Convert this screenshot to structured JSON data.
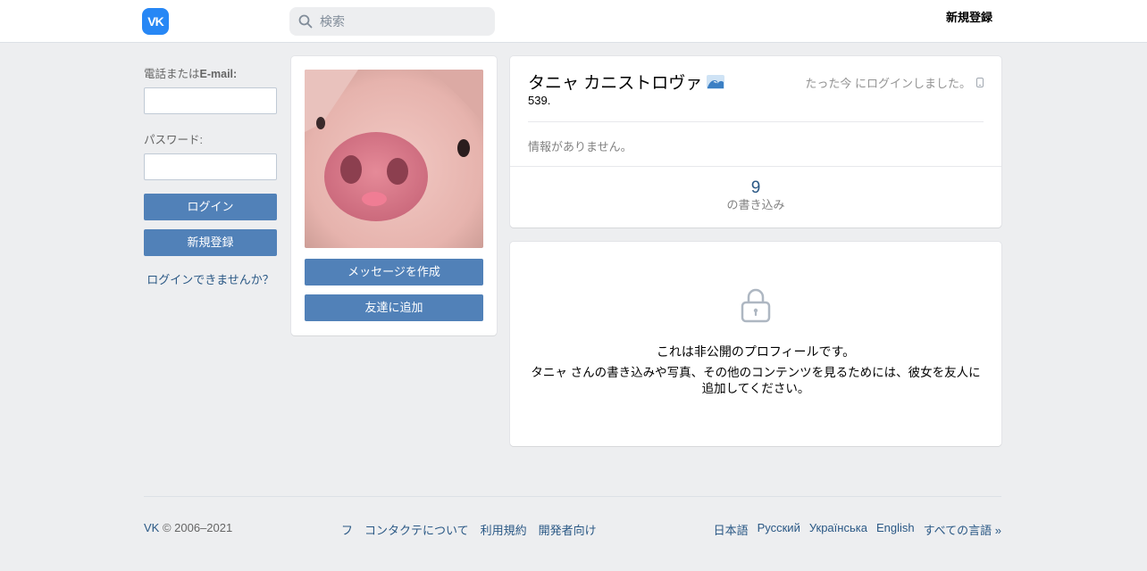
{
  "header": {
    "logo": "VK",
    "search_placeholder": "検索",
    "signup_label": "新規登録"
  },
  "login": {
    "phone_label": "電話または",
    "email_label": "E-mail:",
    "password_label": "パスワード:",
    "login_button": "ログイン",
    "signup_button": "新規登録",
    "forgot_link": "ログインできませんか？"
  },
  "profile": {
    "message_button": "メッセージを作成",
    "add_friend_button": "友達に追加",
    "name": "タニャ カニストロヴァ",
    "status": "539.",
    "online": "たった今 にログインしました。",
    "no_info": "情報がありません。",
    "posts_count": "9",
    "posts_label": "の書き込み"
  },
  "private": {
    "title": "これは非公開のプロフィールです。",
    "text": "タニャ さんの書き込みや写真、その他のコンテンツを見るためには、彼女を友人に追加してください。"
  },
  "footer": {
    "brand": "VK",
    "copyright": "© 2006–2021",
    "links": [
      "フ",
      "コンタクテについて",
      "利用規約",
      "開発者向け"
    ],
    "languages": [
      "日本語",
      "Русский",
      "Українська",
      "English",
      "すべての言語 »"
    ]
  },
  "colors": {
    "accent": "#5181b8",
    "link": "#2a5885",
    "logo": "#2787f5",
    "background": "#edeef0"
  }
}
